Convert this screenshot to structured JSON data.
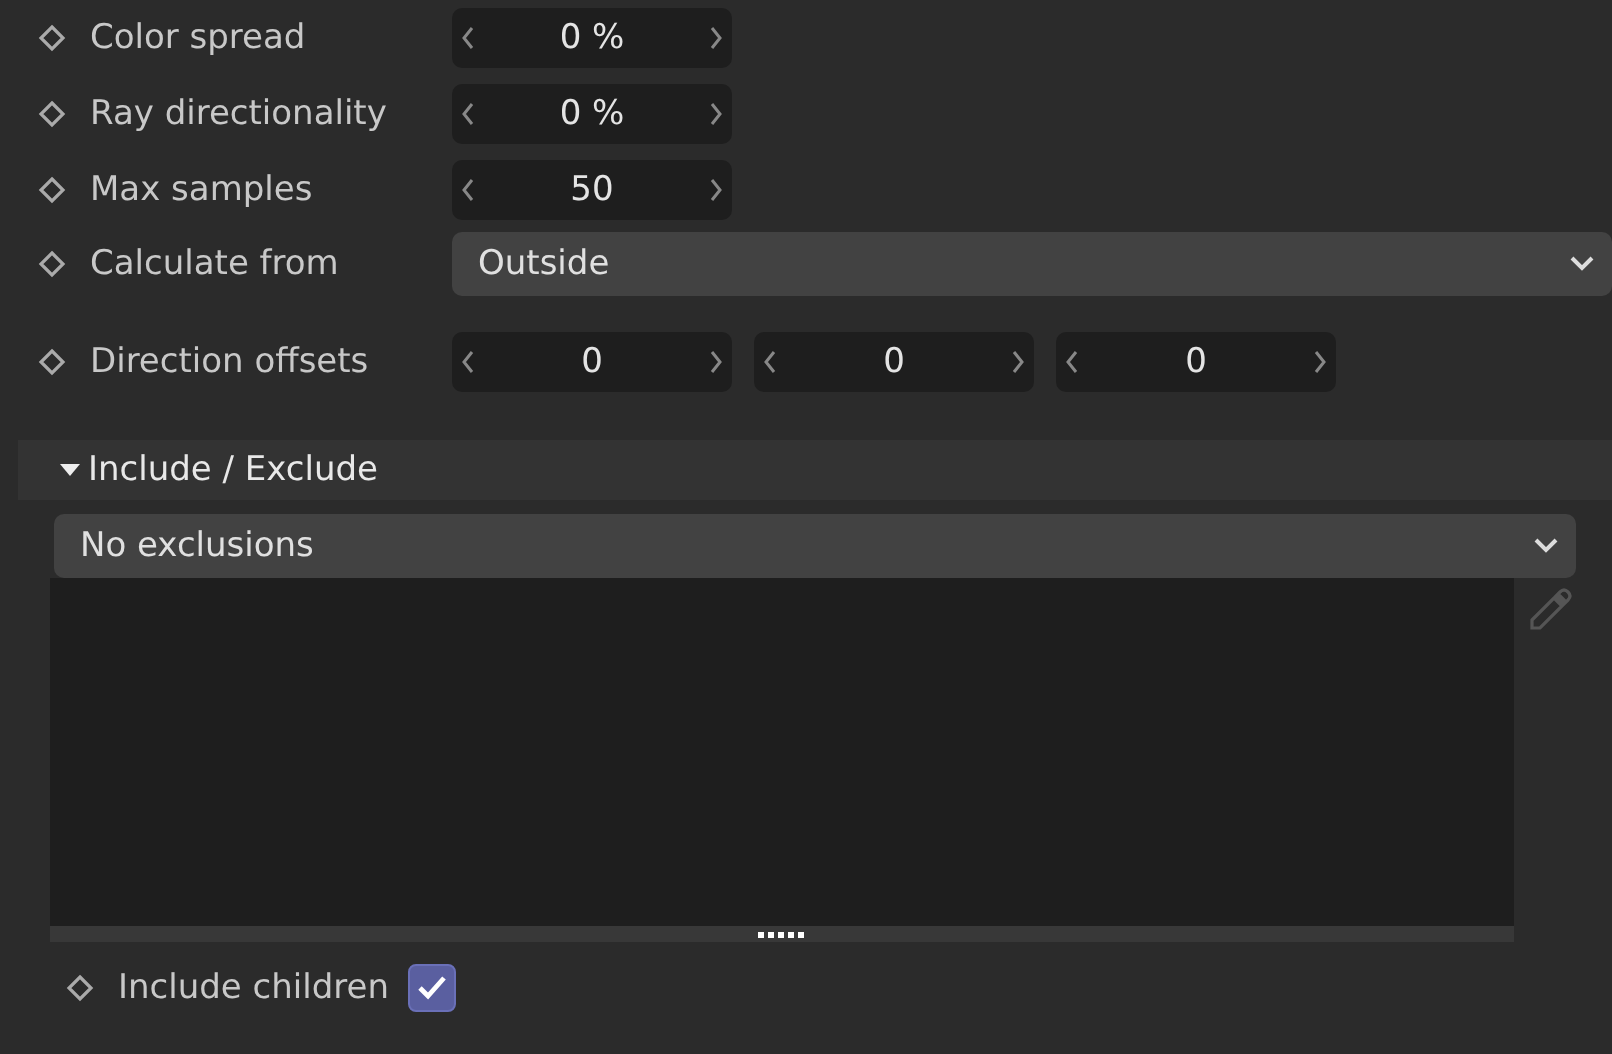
{
  "params": [
    {
      "kind": "number",
      "label": "Color spread",
      "value": "0 %"
    },
    {
      "kind": "number",
      "label": "Ray directionality",
      "value": "0 %"
    },
    {
      "kind": "number",
      "label": "Max samples",
      "value": "50"
    },
    {
      "kind": "dropdown",
      "label": "Calculate from",
      "value": "Outside"
    },
    {
      "kind": "vector",
      "label": "Direction offsets",
      "values": [
        "0",
        "0",
        "0"
      ]
    }
  ],
  "include_exclude": {
    "title": "Include / Exclude",
    "expanded": true,
    "mode": "No exclusions",
    "include_children": {
      "label": "Include children",
      "checked": true
    }
  }
}
